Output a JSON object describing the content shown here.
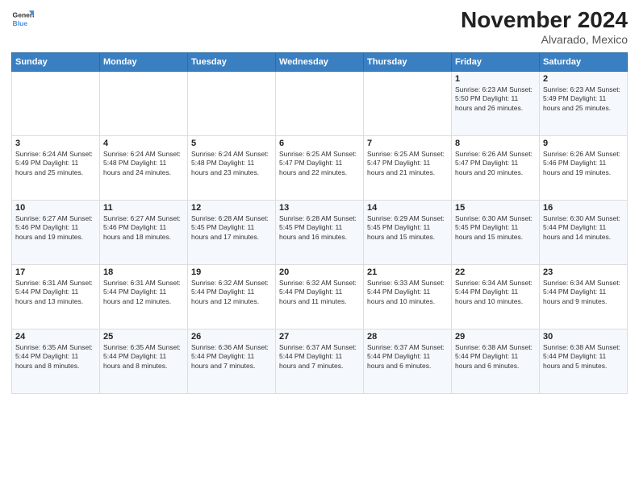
{
  "logo": {
    "line1": "General",
    "line2": "Blue"
  },
  "title": "November 2024",
  "subtitle": "Alvarado, Mexico",
  "days_of_week": [
    "Sunday",
    "Monday",
    "Tuesday",
    "Wednesday",
    "Thursday",
    "Friday",
    "Saturday"
  ],
  "weeks": [
    [
      {
        "day": "",
        "info": ""
      },
      {
        "day": "",
        "info": ""
      },
      {
        "day": "",
        "info": ""
      },
      {
        "day": "",
        "info": ""
      },
      {
        "day": "",
        "info": ""
      },
      {
        "day": "1",
        "info": "Sunrise: 6:23 AM\nSunset: 5:50 PM\nDaylight: 11 hours\nand 26 minutes."
      },
      {
        "day": "2",
        "info": "Sunrise: 6:23 AM\nSunset: 5:49 PM\nDaylight: 11 hours\nand 25 minutes."
      }
    ],
    [
      {
        "day": "3",
        "info": "Sunrise: 6:24 AM\nSunset: 5:49 PM\nDaylight: 11 hours\nand 25 minutes."
      },
      {
        "day": "4",
        "info": "Sunrise: 6:24 AM\nSunset: 5:48 PM\nDaylight: 11 hours\nand 24 minutes."
      },
      {
        "day": "5",
        "info": "Sunrise: 6:24 AM\nSunset: 5:48 PM\nDaylight: 11 hours\nand 23 minutes."
      },
      {
        "day": "6",
        "info": "Sunrise: 6:25 AM\nSunset: 5:47 PM\nDaylight: 11 hours\nand 22 minutes."
      },
      {
        "day": "7",
        "info": "Sunrise: 6:25 AM\nSunset: 5:47 PM\nDaylight: 11 hours\nand 21 minutes."
      },
      {
        "day": "8",
        "info": "Sunrise: 6:26 AM\nSunset: 5:47 PM\nDaylight: 11 hours\nand 20 minutes."
      },
      {
        "day": "9",
        "info": "Sunrise: 6:26 AM\nSunset: 5:46 PM\nDaylight: 11 hours\nand 19 minutes."
      }
    ],
    [
      {
        "day": "10",
        "info": "Sunrise: 6:27 AM\nSunset: 5:46 PM\nDaylight: 11 hours\nand 19 minutes."
      },
      {
        "day": "11",
        "info": "Sunrise: 6:27 AM\nSunset: 5:46 PM\nDaylight: 11 hours\nand 18 minutes."
      },
      {
        "day": "12",
        "info": "Sunrise: 6:28 AM\nSunset: 5:45 PM\nDaylight: 11 hours\nand 17 minutes."
      },
      {
        "day": "13",
        "info": "Sunrise: 6:28 AM\nSunset: 5:45 PM\nDaylight: 11 hours\nand 16 minutes."
      },
      {
        "day": "14",
        "info": "Sunrise: 6:29 AM\nSunset: 5:45 PM\nDaylight: 11 hours\nand 15 minutes."
      },
      {
        "day": "15",
        "info": "Sunrise: 6:30 AM\nSunset: 5:45 PM\nDaylight: 11 hours\nand 15 minutes."
      },
      {
        "day": "16",
        "info": "Sunrise: 6:30 AM\nSunset: 5:44 PM\nDaylight: 11 hours\nand 14 minutes."
      }
    ],
    [
      {
        "day": "17",
        "info": "Sunrise: 6:31 AM\nSunset: 5:44 PM\nDaylight: 11 hours\nand 13 minutes."
      },
      {
        "day": "18",
        "info": "Sunrise: 6:31 AM\nSunset: 5:44 PM\nDaylight: 11 hours\nand 12 minutes."
      },
      {
        "day": "19",
        "info": "Sunrise: 6:32 AM\nSunset: 5:44 PM\nDaylight: 11 hours\nand 12 minutes."
      },
      {
        "day": "20",
        "info": "Sunrise: 6:32 AM\nSunset: 5:44 PM\nDaylight: 11 hours\nand 11 minutes."
      },
      {
        "day": "21",
        "info": "Sunrise: 6:33 AM\nSunset: 5:44 PM\nDaylight: 11 hours\nand 10 minutes."
      },
      {
        "day": "22",
        "info": "Sunrise: 6:34 AM\nSunset: 5:44 PM\nDaylight: 11 hours\nand 10 minutes."
      },
      {
        "day": "23",
        "info": "Sunrise: 6:34 AM\nSunset: 5:44 PM\nDaylight: 11 hours\nand 9 minutes."
      }
    ],
    [
      {
        "day": "24",
        "info": "Sunrise: 6:35 AM\nSunset: 5:44 PM\nDaylight: 11 hours\nand 8 minutes."
      },
      {
        "day": "25",
        "info": "Sunrise: 6:35 AM\nSunset: 5:44 PM\nDaylight: 11 hours\nand 8 minutes."
      },
      {
        "day": "26",
        "info": "Sunrise: 6:36 AM\nSunset: 5:44 PM\nDaylight: 11 hours\nand 7 minutes."
      },
      {
        "day": "27",
        "info": "Sunrise: 6:37 AM\nSunset: 5:44 PM\nDaylight: 11 hours\nand 7 minutes."
      },
      {
        "day": "28",
        "info": "Sunrise: 6:37 AM\nSunset: 5:44 PM\nDaylight: 11 hours\nand 6 minutes."
      },
      {
        "day": "29",
        "info": "Sunrise: 6:38 AM\nSunset: 5:44 PM\nDaylight: 11 hours\nand 6 minutes."
      },
      {
        "day": "30",
        "info": "Sunrise: 6:38 AM\nSunset: 5:44 PM\nDaylight: 11 hours\nand 5 minutes."
      }
    ]
  ]
}
